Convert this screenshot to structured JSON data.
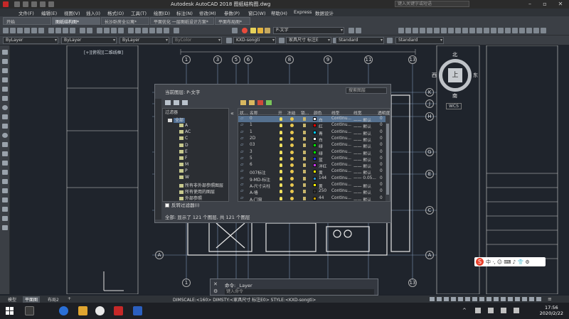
{
  "window": {
    "title": "Autodesk AutoCAD 2018    图纸结构图.dwg",
    "search_placeholder": "键入关键字或短语"
  },
  "menu": [
    "文件(F)",
    "编辑(E)",
    "视图(V)",
    "插入(I)",
    "格式(O)",
    "工具(T)",
    "绘图(D)",
    "标注(N)",
    "修改(M)",
    "参数(P)",
    "窗口(W)",
    "帮助(H)",
    "Express",
    "数据设计"
  ],
  "tabs": [
    "开始",
    "图纸结构图*",
    "长沙卧房全公寓*",
    "平面优化 一层图纸设计方案*",
    "平面布局图*"
  ],
  "ribbon": {
    "layer_combo": "P-文字",
    "color_combo": "ByLayer",
    "linetype_combo": "ByLayer",
    "lineweight_combo": "ByLayer",
    "plotstyle_combo": "ByColor",
    "textstyle_combo": "KXD-songti",
    "dimstyle_combo": "家具尺寸 标注E",
    "tablestyle_combo": "Standard",
    "mleader_combo": "Standard"
  },
  "view_label": "[+][俯视][二维线框]",
  "viewcube": {
    "north": "北",
    "south": "南",
    "east": "东",
    "west": "西",
    "top": "上",
    "wcs": "WCS"
  },
  "layer_dialog": {
    "current_layer": "当前图层: P-文字",
    "search_placeholder": "搜索图层",
    "filter_header": "过滤器",
    "filters": [
      "全部",
      "A",
      "AC",
      "C",
      "D",
      "E",
      "F",
      "M",
      "P",
      "W",
      "所有非外部参照图层",
      "所有使用的图层",
      "外部参照"
    ],
    "invert_label": "反转过滤器(I)",
    "status": "全部: 显示了 121 个图层, 共 121 个图层",
    "side_label": "图层特性管理器",
    "columns": [
      "状...",
      "名称",
      "开",
      "冻结",
      "锁...",
      "颜色",
      "线型",
      "线宽",
      "透明度"
    ],
    "rows": [
      {
        "name": "0",
        "color_name": "白",
        "color": "#ffffff",
        "linetype": "Continu...",
        "lineweight": "—— 默认",
        "transparency": "0"
      },
      {
        "name": "1",
        "color_name": "红",
        "color": "#ff0000",
        "linetype": "Continu...",
        "lineweight": "—— 默认",
        "transparency": "0"
      },
      {
        "name": "1",
        "color_name": "青",
        "color": "#00c8ff",
        "linetype": "Continu...",
        "lineweight": "—— 默认",
        "transparency": "0"
      },
      {
        "name": "2D",
        "color_name": "白",
        "color": "#ffffff",
        "linetype": "Continu...",
        "lineweight": "—— 默认",
        "transparency": "0"
      },
      {
        "name": "03",
        "color_name": "绿",
        "color": "#00ff00",
        "linetype": "Continu...",
        "lineweight": "—— 默认",
        "transparency": "0"
      },
      {
        "name": "3",
        "color_name": "绿",
        "color": "#00ff00",
        "linetype": "Continu...",
        "lineweight": "—— 默认",
        "transparency": "0"
      },
      {
        "name": "5",
        "color_name": "蓝",
        "color": "#1e3cff",
        "linetype": "Continu...",
        "lineweight": "—— 默认",
        "transparency": "0"
      },
      {
        "name": "6",
        "color_name": "洋红",
        "color": "#d030ff",
        "linetype": "Continu...",
        "lineweight": "—— 默认",
        "transparency": "0"
      },
      {
        "name": "007标注",
        "color_name": "黄",
        "color": "#ffff00",
        "linetype": "Continu...",
        "lineweight": "—— 默认",
        "transparency": "0"
      },
      {
        "name": "9-MD-标注",
        "color_name": "144",
        "color": "#2c8fd0",
        "linetype": "Continu...",
        "lineweight": "—— 0.05...",
        "transparency": "0"
      },
      {
        "name": "A-尺寸尖柱",
        "color_name": "黄",
        "color": "#ffff00",
        "linetype": "Continu...",
        "lineweight": "—— 默认",
        "transparency": "0"
      },
      {
        "name": "A-墙",
        "color_name": "250",
        "color": "#3a3a3a",
        "linetype": "Continu...",
        "lineweight": "—— 默认",
        "transparency": "0"
      },
      {
        "name": "A-门窗",
        "color_name": "44",
        "color": "#c8a000",
        "linetype": "Continu...",
        "lineweight": "—— 默认",
        "transparency": "0"
      }
    ]
  },
  "command_line": {
    "history": "命令: _Layer",
    "prompt": "键入命令"
  },
  "layout_tabs": [
    "模型",
    "平面图",
    "布局2"
  ],
  "status_bar": "DIMSCALE:<160>  DIMSTY:<家具尺寸 标注E0> STYLE:<KXD-songti>",
  "taskbar": {
    "time": "17:56",
    "date": "2020/2/22"
  },
  "ime": {
    "logo": "S",
    "text": "中 ·, ☺ ⌨ ♪ 👕 ⚙"
  },
  "axis_labels": {
    "top": [
      "1",
      "3",
      "5",
      "6",
      "8",
      "9",
      "11",
      "13"
    ],
    "right": [
      "K",
      "J",
      "H",
      "G",
      "E",
      "C",
      "A"
    ],
    "bottom": [
      "1",
      "3",
      "9",
      "11",
      "13"
    ]
  }
}
